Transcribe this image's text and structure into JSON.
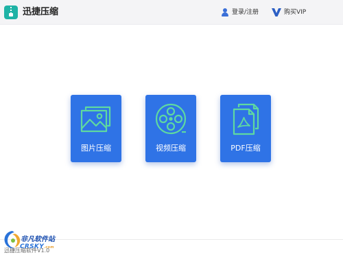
{
  "header": {
    "title": "迅捷压缩",
    "logo_icon": "zip-folder-icon",
    "login_label": "登录/注册",
    "login_icon": "user-icon",
    "vip_label": "购买VIP",
    "vip_icon": "vip-v-icon"
  },
  "cards": [
    {
      "label": "图片压缩",
      "icon": "image-icon"
    },
    {
      "label": "视频压缩",
      "icon": "film-reel-icon"
    },
    {
      "label": "PDF压缩",
      "icon": "pdf-document-icon"
    }
  ],
  "footer": {
    "watermark_title": "非凡软件站",
    "watermark_brand": "CRSKY",
    "watermark_tld": ".com",
    "version_text": "迅捷压缩软件V1.0"
  },
  "colors": {
    "accent": "#2f73e6",
    "icon_green": "#5fd9a0",
    "logo_teal": "#1fb3a6",
    "header_bg": "#f4f4f6"
  }
}
